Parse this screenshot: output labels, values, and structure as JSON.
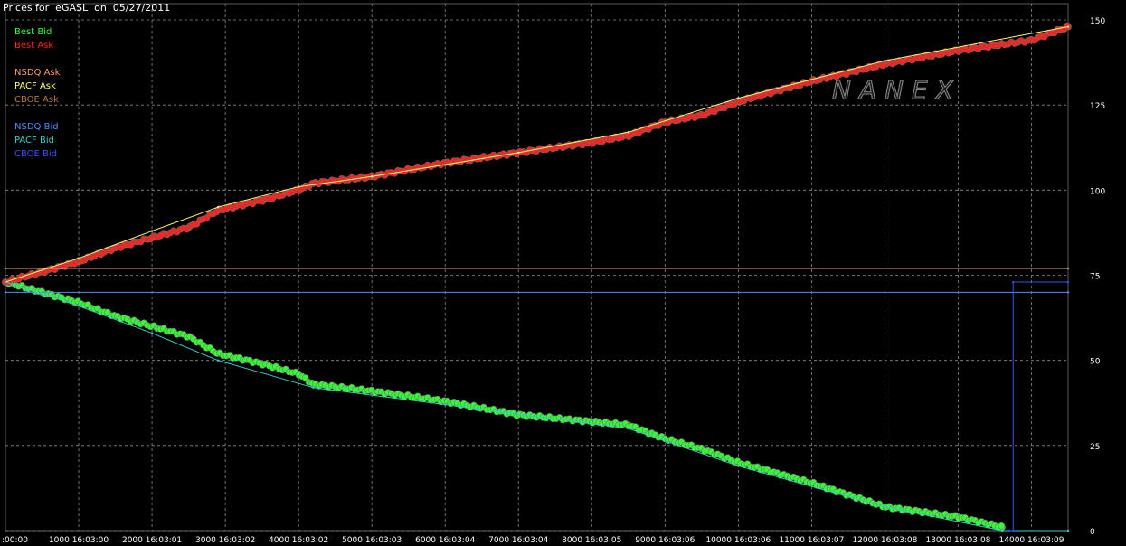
{
  "title": "Prices for  eGASL  on  05/27/2011",
  "watermark": "NANEX",
  "legend": [
    {
      "label": "Best Bid",
      "color": "#33ff33"
    },
    {
      "label": "Best Ask",
      "color": "#ff2020"
    },
    {
      "label": "NSDQ Ask",
      "color": "#ff9b5a"
    },
    {
      "label": "PACF Ask",
      "color": "#ffff66"
    },
    {
      "label": "CBOE Ask",
      "color": "#b07a3a"
    },
    {
      "label": "NSDQ Bid",
      "color": "#4f8cff"
    },
    {
      "label": "PACF Bid",
      "color": "#33cccc"
    },
    {
      "label": "CBOE Bid",
      "color": "#3355ee"
    }
  ],
  "chart_data": {
    "type": "scatter",
    "xlim": [
      0,
      14500
    ],
    "ylim": [
      0,
      150
    ],
    "grid": true,
    "legend_position": "top-left",
    "y_axis_side": "right",
    "y_ticks": [
      0,
      25,
      50,
      75,
      100,
      125,
      150
    ],
    "x_ticks": [
      {
        "x": 0,
        "label": ":00:00"
      },
      {
        "x": 1000,
        "label": "1000 16:03:00"
      },
      {
        "x": 2000,
        "label": "2000 16:03:01"
      },
      {
        "x": 3000,
        "label": "3000 16:03:02"
      },
      {
        "x": 4000,
        "label": "4000 16:03:02"
      },
      {
        "x": 5000,
        "label": "5000 16:03:03"
      },
      {
        "x": 6000,
        "label": "6000 16:03:04"
      },
      {
        "x": 7000,
        "label": "7000 16:03:04"
      },
      {
        "x": 8000,
        "label": "8000 16:03:05"
      },
      {
        "x": 9000,
        "label": "9000 16:03:06"
      },
      {
        "x": 10000,
        "label": "10000 16:03:06"
      },
      {
        "x": 11000,
        "label": "11000 16:03:07"
      },
      {
        "x": 12000,
        "label": "12000 16:03:08"
      },
      {
        "x": 13000,
        "label": "13000 16:03:08"
      },
      {
        "x": 14000,
        "label": "14000 16:03:09"
      }
    ],
    "series": [
      {
        "name": "Best Bid",
        "color": "#33ff33",
        "x": [
          0,
          500,
          1000,
          1500,
          2000,
          2500,
          2900,
          3500,
          4000,
          4200,
          5000,
          6000,
          7000,
          8000,
          8500,
          9000,
          9500,
          10000,
          11000,
          12000,
          13000,
          13600
        ],
        "y": [
          73,
          70,
          67,
          63,
          60,
          57,
          52,
          49,
          46,
          43,
          41,
          38,
          34,
          32,
          31,
          27,
          24,
          20,
          14,
          7,
          4,
          1
        ]
      },
      {
        "name": "Best Ask",
        "color": "#ff2020",
        "x": [
          0,
          500,
          1000,
          1500,
          2000,
          2500,
          2900,
          3500,
          4000,
          4200,
          5000,
          6000,
          7000,
          8000,
          8500,
          9000,
          9500,
          10000,
          11000,
          12000,
          13000,
          14000,
          14500
        ],
        "y": [
          73,
          76,
          79,
          83,
          86,
          89,
          94,
          97,
          100,
          102,
          104,
          108,
          111,
          114,
          116,
          120,
          122,
          126,
          132,
          137,
          141,
          144,
          148
        ]
      },
      {
        "name": "NSDQ Ask",
        "color": "#ff9b5a",
        "x": [
          0,
          14500
        ],
        "y": [
          77,
          77
        ]
      },
      {
        "name": "PACF Ask",
        "color": "#ffff66",
        "x": [
          0,
          1000,
          2000,
          2900,
          4000,
          5000,
          7000,
          8500,
          10000,
          12000,
          14500
        ],
        "y": [
          73,
          80,
          88,
          95,
          101,
          104,
          111,
          117,
          127,
          138,
          148
        ]
      },
      {
        "name": "NSDQ Bid",
        "color": "#4f8cff",
        "x": [
          0,
          14500
        ],
        "y": [
          70,
          70
        ]
      },
      {
        "name": "PACF Bid",
        "color": "#33cccc",
        "x": [
          0,
          1000,
          2000,
          2900,
          4200,
          6000,
          8500,
          10000,
          12000,
          13600,
          14500
        ],
        "y": [
          73,
          66,
          58,
          50,
          42,
          37,
          30,
          19,
          7,
          0,
          0
        ]
      },
      {
        "name": "CBOE Bid",
        "color": "#3355ee",
        "x": [
          13700,
          13750,
          13750,
          14500
        ],
        "y": [
          0,
          0,
          73,
          73
        ]
      }
    ]
  }
}
